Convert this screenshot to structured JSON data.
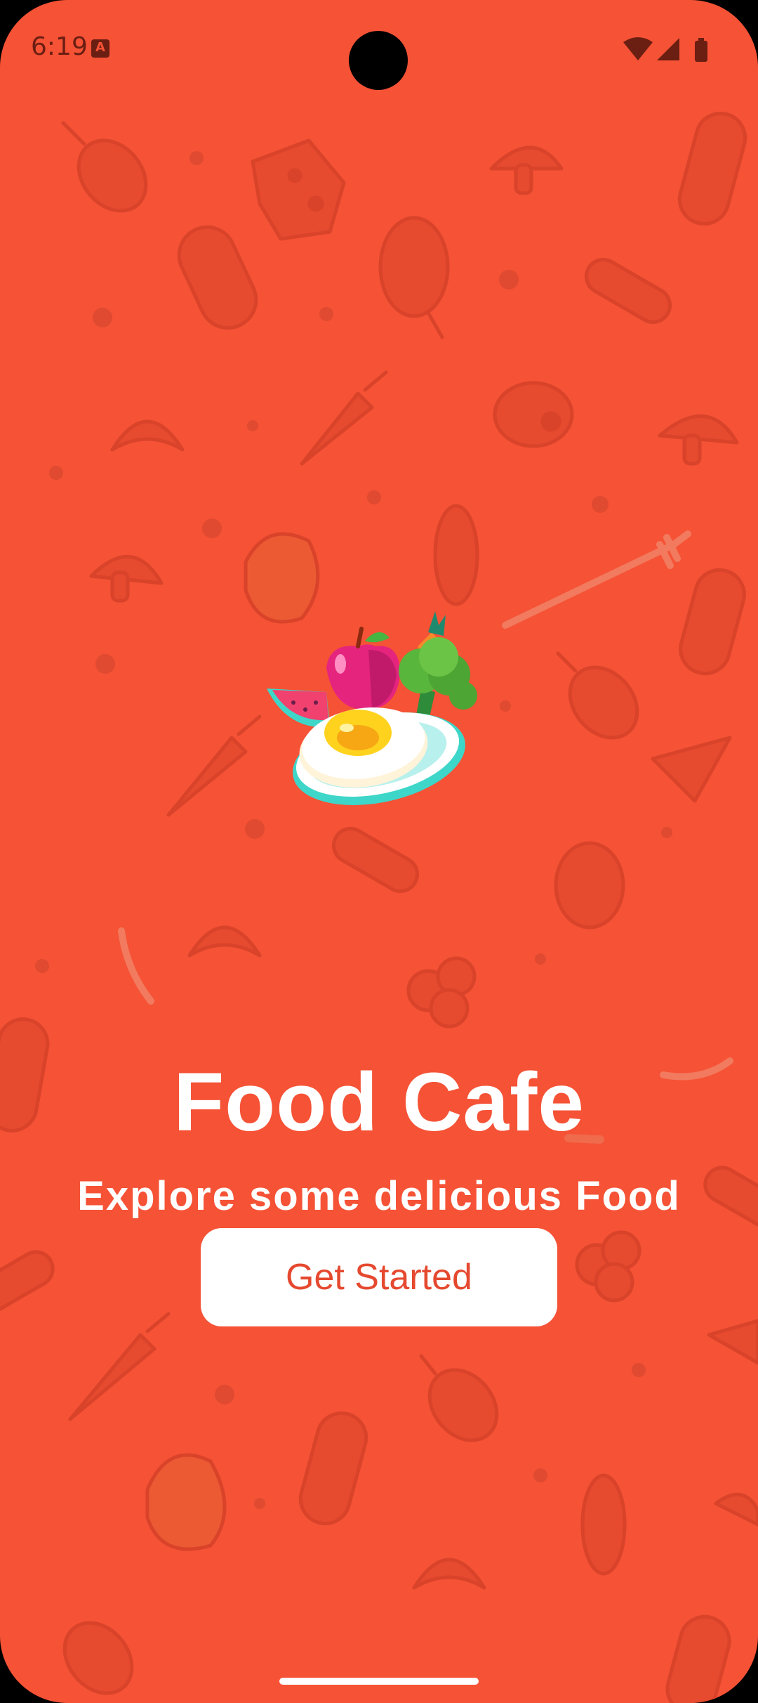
{
  "status_bar": {
    "time": "6:19",
    "notification_icon": "a-letter-icon",
    "icons": [
      "wifi-icon",
      "signal-icon",
      "battery-icon"
    ]
  },
  "welcome": {
    "illustration": "food-plate-illustration",
    "title": "Food Cafe",
    "subtitle": "Explore some delicious Food",
    "button_label": "Get Started"
  },
  "colors": {
    "background": "#F55236",
    "button_background": "#FFFFFF",
    "button_text": "#E5492F",
    "title_text": "#FFFFFF"
  }
}
